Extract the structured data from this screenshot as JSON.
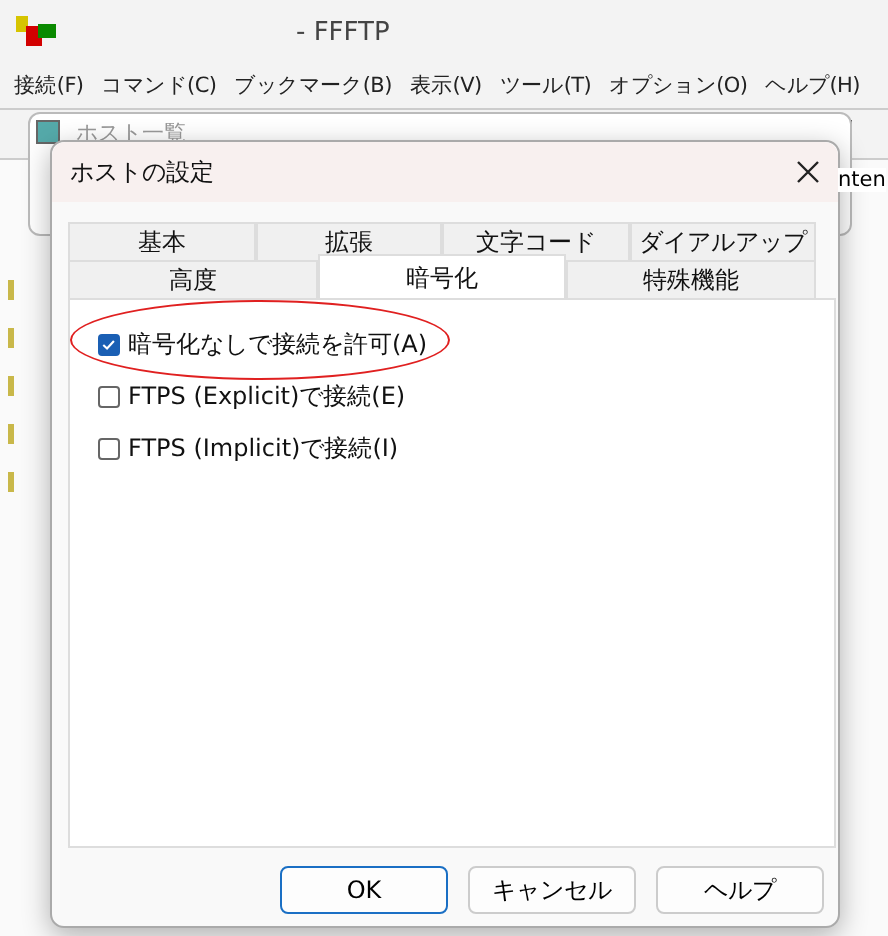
{
  "window": {
    "title": "- FFFTP"
  },
  "menu": [
    "接続(F)",
    "コマンド(C)",
    "ブックマーク(B)",
    "表示(V)",
    "ツール(T)",
    "オプション(O)",
    "ヘルプ(H)"
  ],
  "host_list_window": {
    "title": "ホスト一覧",
    "column_text": "nten"
  },
  "dialog": {
    "title": "ホストの設定",
    "tab_rows": [
      [
        {
          "label": "基本",
          "selected": false
        },
        {
          "label": "拡張",
          "selected": false
        },
        {
          "label": "文字コード",
          "selected": false
        },
        {
          "label": "ダイアルアップ",
          "selected": false
        }
      ],
      [
        {
          "label": "高度",
          "selected": false
        },
        {
          "label": "暗号化",
          "selected": true
        },
        {
          "label": "特殊機能",
          "selected": false
        }
      ]
    ],
    "options": [
      {
        "label": "暗号化なしで接続を許可(A)",
        "checked": true,
        "circled": true
      },
      {
        "label": "FTPS (Explicit)で接続(E)",
        "checked": false,
        "circled": false
      },
      {
        "label": "FTPS (Implicit)で接続(I)",
        "checked": false,
        "circled": false
      }
    ],
    "buttons": [
      {
        "label": "OK",
        "default": true
      },
      {
        "label": "キャンセル",
        "default": false
      },
      {
        "label": "ヘルプ",
        "default": false
      }
    ]
  }
}
